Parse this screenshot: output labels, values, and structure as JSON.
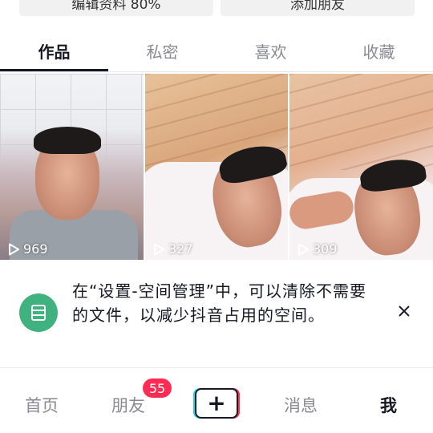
{
  "top_buttons": {
    "left_label": "编辑资料 80%",
    "right_label": "添加朋友"
  },
  "tabs": [
    {
      "label": "作品",
      "active": true
    },
    {
      "label": "私密",
      "active": false
    },
    {
      "label": "喜欢",
      "active": false
    },
    {
      "label": "收藏",
      "active": false
    }
  ],
  "videos": [
    {
      "views": "969"
    },
    {
      "views": "327"
    },
    {
      "views": "309"
    }
  ],
  "notice": {
    "text": "在“设置-空间管理”中，可以清除不需要的文件，以减少抖音占用的空间。",
    "icon": "storage-icon",
    "icon_color": "#3fb27f"
  },
  "bottom_nav": {
    "home": "首页",
    "friends": "朋友",
    "friends_badge": "55",
    "add_icon": "+",
    "messages": "消息",
    "me": "我"
  },
  "colors": {
    "accent_red": "#fe2c55",
    "accent_cyan": "#20d5ec",
    "text_primary": "#161823",
    "text_secondary": "#8a8b91"
  }
}
